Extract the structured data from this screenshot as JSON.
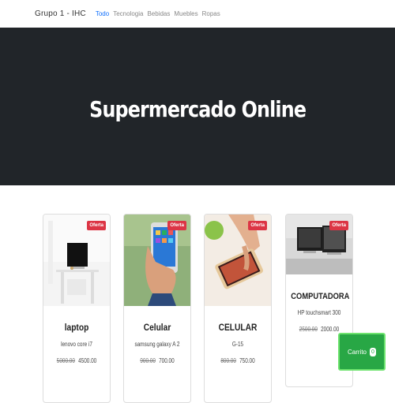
{
  "navbar": {
    "brand": "Grupo 1 - IHC",
    "links": [
      "Todo",
      "Tecnologia",
      "Bebidas",
      "Muebles",
      "Ropas"
    ],
    "active_index": 0
  },
  "hero": {
    "title": "Supermercado Online"
  },
  "products": [
    {
      "badge": "Oferta",
      "title": "laptop",
      "subtitle": "lenovo core i7",
      "old_price": "5000.00",
      "price": "4500.00"
    },
    {
      "badge": "Oferta",
      "title": "Celular",
      "subtitle": "samsung galaxy A 2",
      "old_price": "900.00",
      "price": "700.00"
    },
    {
      "badge": "Oferta",
      "title": "CELULAR",
      "subtitle": "G-15",
      "old_price": "800.00",
      "price": "750.00"
    },
    {
      "badge": "Oferta",
      "title": "COMPUTADORA",
      "subtitle": "HP touchsmart 300",
      "old_price": "2500.00",
      "price": "2000.00"
    }
  ],
  "cart": {
    "label": "Carrito",
    "count": "0"
  },
  "colors": {
    "hero_bg": "#212529",
    "badge": "#dc3545",
    "cart": "#28a745",
    "active_link": "#0d6efd"
  }
}
